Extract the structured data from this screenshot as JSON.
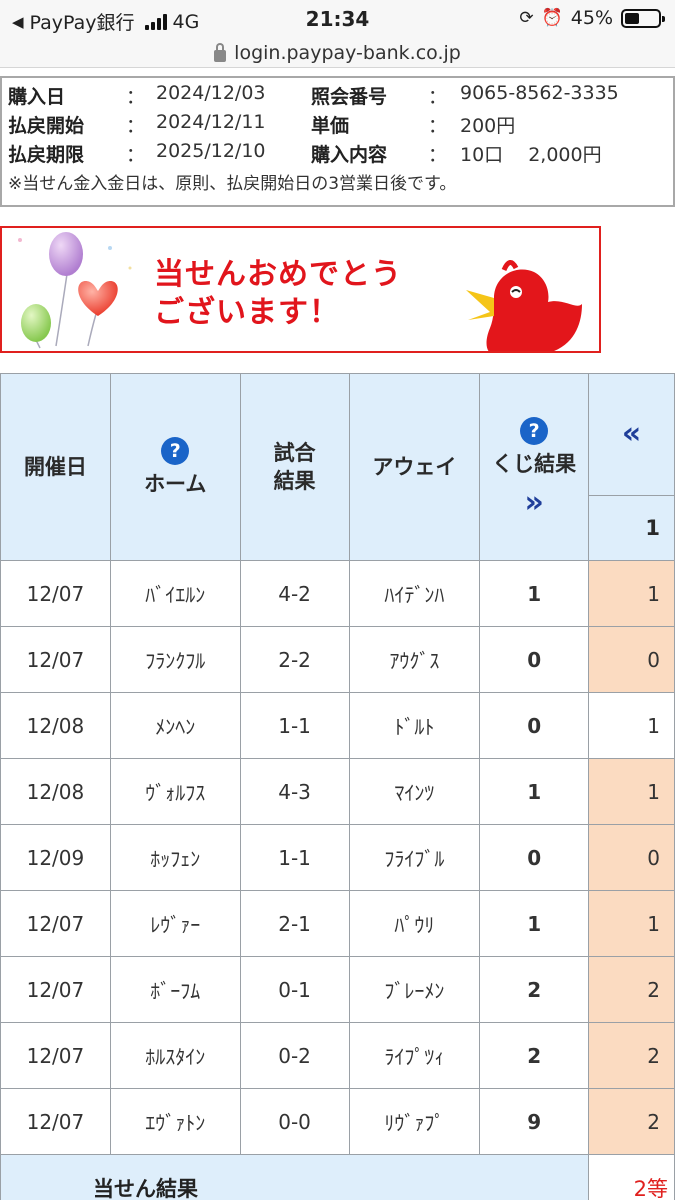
{
  "status_bar": {
    "carrier": "PayPay銀行",
    "network": "4G",
    "time": "21:34",
    "battery": "45%",
    "battery_level": 0.45
  },
  "url_bar": {
    "domain": "login.paypay-bank.co.jp"
  },
  "purchase_info": {
    "colon": "：",
    "left": [
      {
        "label": "購入日",
        "value": "2024/12/03"
      },
      {
        "label": "払戻開始",
        "value": "2024/12/11"
      },
      {
        "label": "払戻期限",
        "value": "2025/12/10"
      }
    ],
    "right": [
      {
        "label": "照会番号",
        "value": "9065-8562-3335"
      },
      {
        "label": "単価",
        "value": "200円"
      },
      {
        "label": "購入内容",
        "value": "10口　 2,000円"
      }
    ],
    "note": "※当せん金入金日は、原則、払戻開始日の3営業日後です。"
  },
  "banner": {
    "line1": "当せんおめでとう",
    "line2": "ございます！",
    "colors": {
      "border": "#e0201e",
      "text": "#e1151c"
    }
  },
  "table": {
    "headers": {
      "date": "開催日",
      "home": "ホーム",
      "result": "試合結果",
      "away": "アウェイ",
      "lottery": "くじ結果",
      "extra_col": "1"
    },
    "help_icon": "?",
    "nav_prev": "«",
    "nav_next": "»",
    "rows": [
      {
        "date": "12/07",
        "home": "ﾊﾞｲｴﾙﾝ",
        "score": "4-2",
        "away": "ﾊｲﾃﾞﾝﾊ",
        "lottery": "1",
        "pick": "1",
        "hit": true
      },
      {
        "date": "12/07",
        "home": "ﾌﾗﾝｸﾌﾙ",
        "score": "2-2",
        "away": "ｱｳｸﾞｽ",
        "lottery": "0",
        "pick": "0",
        "hit": true
      },
      {
        "date": "12/08",
        "home": "ﾒﾝﾍﾝ",
        "score": "1-1",
        "away": "ﾄﾞﾙﾄ",
        "lottery": "0",
        "pick": "1",
        "hit": false
      },
      {
        "date": "12/08",
        "home": "ｳﾞｫﾙﾌｽ",
        "score": "4-3",
        "away": "ﾏｲﾝﾂ",
        "lottery": "1",
        "pick": "1",
        "hit": true
      },
      {
        "date": "12/09",
        "home": "ﾎｯﾌｪﾝ",
        "score": "1-1",
        "away": "ﾌﾗｲﾌﾞﾙ",
        "lottery": "0",
        "pick": "0",
        "hit": true
      },
      {
        "date": "12/07",
        "home": "ﾚｳﾞｧｰ",
        "score": "2-1",
        "away": "ﾊﾟｳﾘ",
        "lottery": "1",
        "pick": "1",
        "hit": true
      },
      {
        "date": "12/07",
        "home": "ﾎﾞｰﾌﾑ",
        "score": "0-1",
        "away": "ﾌﾞﾚｰﾒﾝ",
        "lottery": "2",
        "pick": "2",
        "hit": true
      },
      {
        "date": "12/07",
        "home": "ﾎﾙｽﾀｲﾝ",
        "score": "0-2",
        "away": "ﾗｲﾌﾟﾂｨ",
        "lottery": "2",
        "pick": "2",
        "hit": true
      },
      {
        "date": "12/07",
        "home": "ｴｳﾞｧﾄﾝ",
        "score": "0-0",
        "away": "ﾘｳﾞｧﾌﾟ",
        "lottery": "9",
        "pick": "2",
        "hit": true
      }
    ],
    "summary": {
      "label": "当せん結果",
      "grade": "2等"
    },
    "colors": {
      "header_bg": "#deeefb",
      "hit_bg": "#fbdbc1",
      "chevron": "#1f3e9a",
      "help": "#1a64c8"
    }
  }
}
